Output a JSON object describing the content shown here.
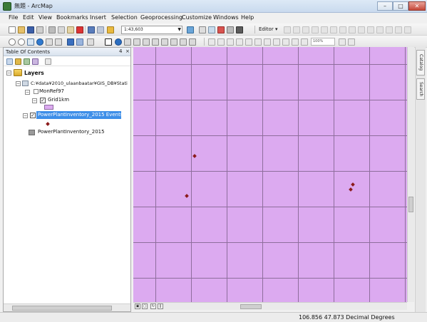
{
  "window": {
    "title": "無題 - ArcMap",
    "controls": {
      "minimize": "–",
      "maximize": "□",
      "close": "✕"
    }
  },
  "menu": [
    "File",
    "Edit",
    "View",
    "Bookmarks",
    "Insert",
    "Selection",
    "Geoprocessing",
    "Customize",
    "Windows",
    "Help"
  ],
  "toolbar": {
    "scale": "1:43,603",
    "editor": "Editor ▾",
    "zoom": "100%"
  },
  "toc": {
    "title": "Table Of Contents",
    "pin": "4",
    "close": "×",
    "root": "Layers",
    "folder": "C:¥data¥2010_ulaanbaatar¥GIS_DB¥Stati",
    "group": "MonRef97",
    "layer_grid": "Grid1km",
    "layer_events": "PowerPlantInventory_2015 Events",
    "table": "PowerPlantInventory_2015"
  },
  "right_dock": {
    "catalog": "Catalog",
    "search": "Search"
  },
  "status": {
    "coords": "106.856  47.873 Decimal Degrees"
  },
  "colors": {
    "polygon_fill": "#dcaaf0",
    "grid_line": "#8e6e9c",
    "point": "#8b1a1a",
    "selection": "#3d8ee8"
  }
}
